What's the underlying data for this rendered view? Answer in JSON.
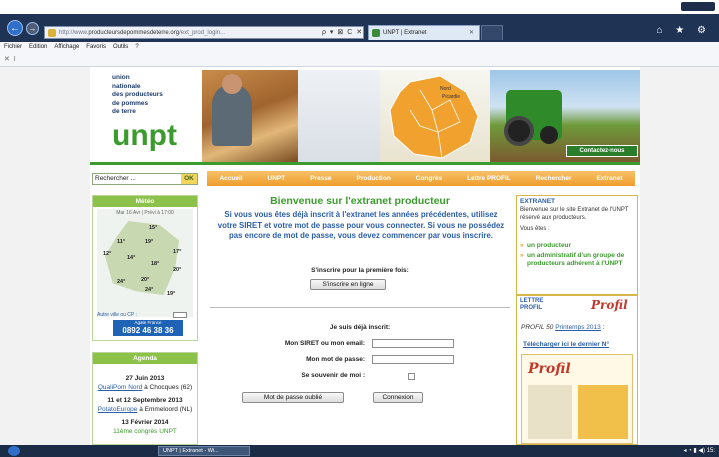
{
  "browser": {
    "address_prefix": "http://www.",
    "address_domain": "producteursdepommesdeterre.org",
    "address_suffix": "/ext_prod_login...",
    "address_controls": "ρ ▾ ⊠ C ✕",
    "tab_title": "UNPT | Extranet",
    "tab_close": "✕",
    "right_icons": "⌂ ★ ⚙",
    "menu": [
      "Fichier",
      "Edition",
      "Affichage",
      "Favoris",
      "Outils",
      "?"
    ],
    "favbar_text": "✕ 𝍷"
  },
  "logo": {
    "line1": "union",
    "line2": "nationale",
    "line3": "des producteurs",
    "line4": "de pommes",
    "line5": "de terre",
    "mark": "unpt"
  },
  "banner": {
    "contact": "Contactez-nous",
    "map_place_1": "Nord",
    "map_place_2": "Picardie"
  },
  "search": {
    "placeholder": "Rechercher ...",
    "ok": "OK"
  },
  "nav": [
    "Accueil",
    "UNPT",
    "Presse",
    "Production",
    "Congrès",
    "Lettre PROFIL",
    "Rechercher",
    "Extranet"
  ],
  "meteo": {
    "title": "Météo",
    "header": "Mar 16 Avr | Prévi à 17:00",
    "temps": [
      "15°",
      "11°",
      "19°",
      "17°",
      "12°",
      "14°",
      "18°",
      "20°",
      "24°",
      "20°",
      "24°",
      "19°"
    ],
    "footer": "Autre ville ou CP :",
    "phone_label": "Agate France",
    "phone": "0892 46 38 36"
  },
  "agenda": {
    "title": "Agenda",
    "items": [
      {
        "date": "27 Juin 2013",
        "link": "QualiPom Nord",
        "place": " à Chocques (62)"
      },
      {
        "date": "11 et 12 Septembre 2013",
        "link": "PotatoEurope",
        "place": " à Emmeloord (NL)"
      },
      {
        "date": "13 Février 2014",
        "link": "11ème congrès UNPT",
        "place": ""
      }
    ]
  },
  "main": {
    "welcome": "Bienvenue sur l'extranet producteur",
    "intro": "Si vous vous êtes déjà inscrit à l'extranet les années précédentes, utilisez votre SIRET et votre mot de passe pour vous connecter. Si vous ne possédez pas encore de mot de passe, vous devez commencer par vous inscrire.",
    "first_time": "S'inscrire pour la première fois:",
    "register_button": "S'inscrire en ligne",
    "already": "Je suis déjà inscrit:",
    "siret_label": "Mon SIRET ou mon email:",
    "password_label": "Mon mot de passe:",
    "remember_label": "Se souvenir de moi :",
    "forgot_button": "Mot de passe oublié",
    "connect_button": "Connexion"
  },
  "extranet_box": {
    "title": "EXTRANET",
    "text": "Bienvenue sur le site Extranet de l'UNPT réservé aux producteurs.",
    "you_are": "Vous êtes :",
    "options": [
      "un producteur",
      "un administratif d'un groupe de producteurs adhérent à l'UNPT"
    ]
  },
  "lettre_box": {
    "title": "LETTRE PROFIL",
    "logo": "Profil",
    "edition_prefix": "PROFIL 50 ",
    "edition_link": "Printemps 2013",
    "edition_suffix": " :",
    "download": "Télécharger ici le dernier N°",
    "cover_title": "Profil"
  },
  "taskbar": {
    "item": "UNPT | Extranet - Wi...",
    "tray": "◂ ◔ ▮ ◀) 15:"
  }
}
